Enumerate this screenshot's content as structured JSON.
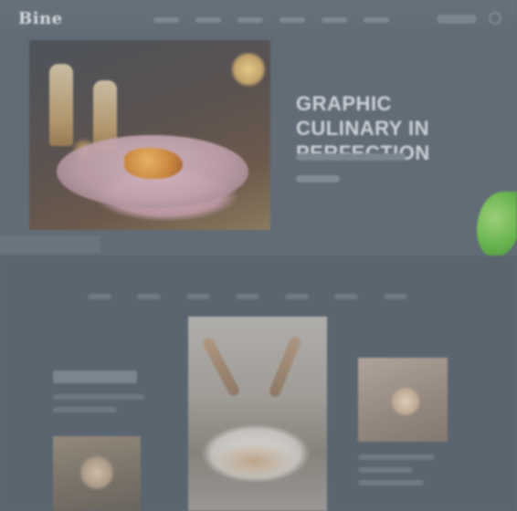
{
  "header": {
    "logo_text": "Bine"
  },
  "hero": {
    "title": "GRAPHIC CULINARY IN PERFECTION"
  },
  "colors": {
    "background": "#5f6b76",
    "accent_leaf": "#6cc24a"
  },
  "icons": {
    "header_icon": "circle-icon"
  }
}
